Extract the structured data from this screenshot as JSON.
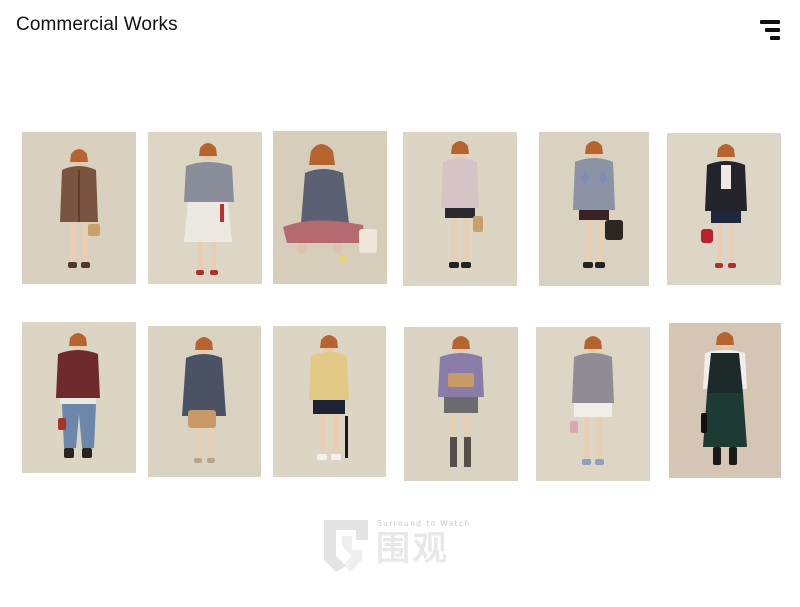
{
  "header": {
    "title": "Commercial Works",
    "menu_icon": "menu-icon"
  },
  "gallery": {
    "rows": 2,
    "columns": 6,
    "items": [
      {
        "row": 1,
        "col": 1,
        "outfit": "brown coat with bag",
        "background": "#d9d0bf"
      },
      {
        "row": 1,
        "col": 2,
        "outfit": "grey cardigan with white skirt",
        "background": "#ddd6c5"
      },
      {
        "row": 1,
        "col": 3,
        "outfit": "seated in grey knit and pink trousers",
        "background": "#d6cdbb"
      },
      {
        "row": 1,
        "col": 4,
        "outfit": "pale pink cardigan with black shorts",
        "background": "#ddd5c4"
      },
      {
        "row": 1,
        "col": 5,
        "outfit": "argyle cardigan with black bag",
        "background": "#dad2c1"
      },
      {
        "row": 1,
        "col": 6,
        "outfit": "black jacket with red bag",
        "background": "#ddd6c6"
      },
      {
        "row": 2,
        "col": 1,
        "outfit": "burgundy sweater with jeans",
        "background": "#dcd5c4"
      },
      {
        "row": 2,
        "col": 2,
        "outfit": "navy cardigan with straw bag",
        "background": "#dbd3c2"
      },
      {
        "row": 2,
        "col": 3,
        "outfit": "yellow knit with navy skirt",
        "background": "#ddd5c4"
      },
      {
        "row": 2,
        "col": 4,
        "outfit": "lilac cardigan with grey shorts",
        "background": "#dbd3c2"
      },
      {
        "row": 2,
        "col": 5,
        "outfit": "grey cardigan with white skirt",
        "background": "#ddd6c5"
      },
      {
        "row": 2,
        "col": 6,
        "outfit": "black vest with long skirt",
        "background": "#d4c5b4"
      }
    ]
  },
  "watermark": {
    "tagline": "Surround to Watch",
    "name": "围观"
  }
}
